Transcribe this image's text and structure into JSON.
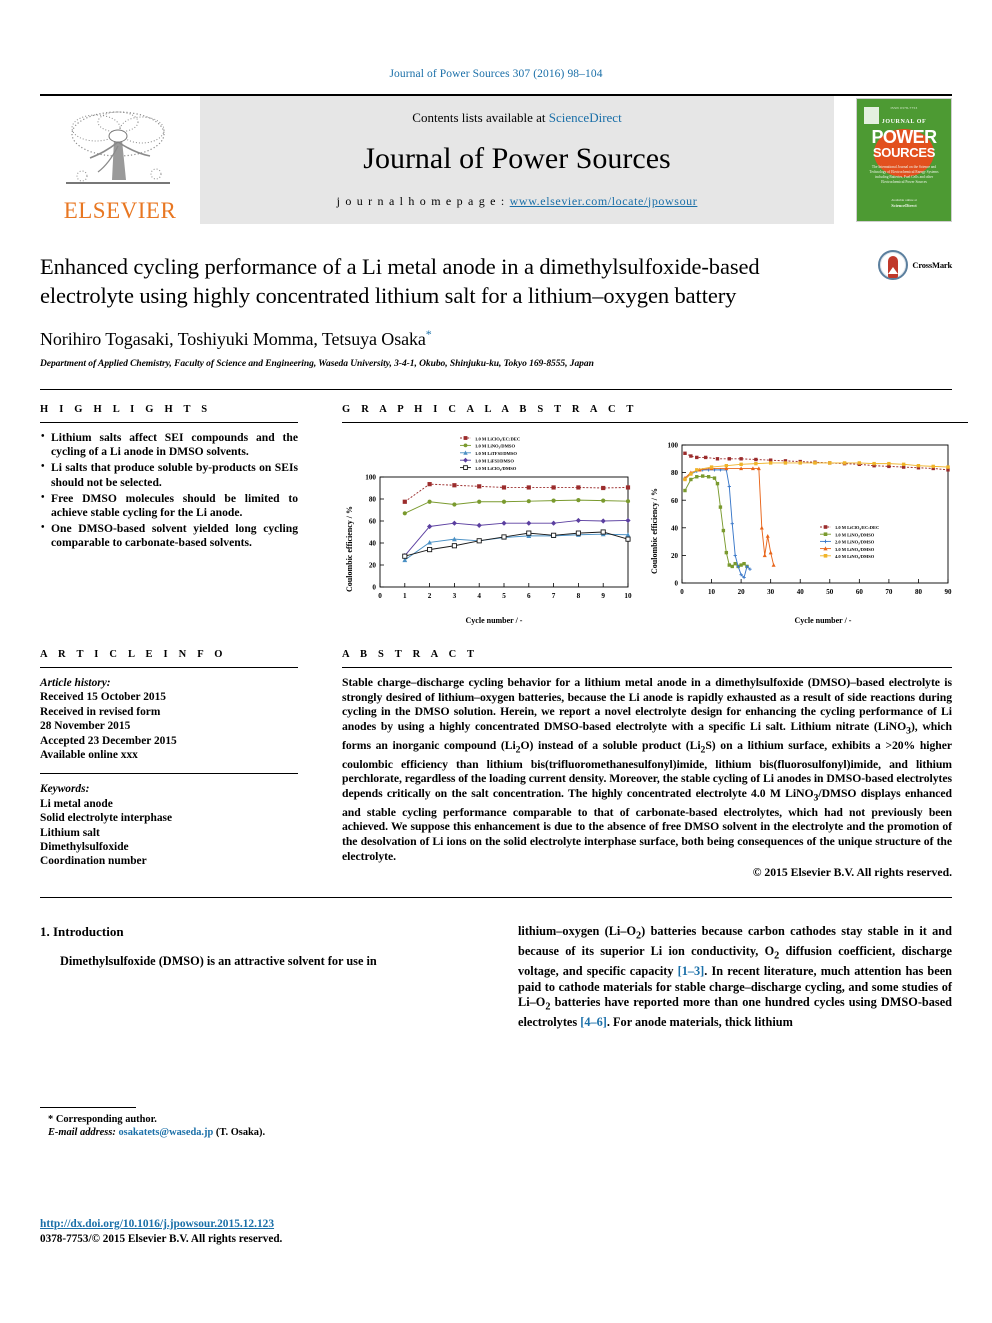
{
  "runninghead": "Journal of Power Sources 307 (2016) 98–104",
  "masthead": {
    "contents_prefix": "Contents lists available at ",
    "sciencedirect": "ScienceDirect",
    "journal_name": "Journal of Power Sources",
    "homepage_label": "j o u r n a l   h o m e p a g e :   ",
    "homepage_url": "www.elsevier.com/locate/jpowsour",
    "elsevier_wordmark": "ELSEVIER",
    "cover": {
      "top_note": "ISSN 0378-7753",
      "journal_of": "JOURNAL OF",
      "power": "POWER",
      "sources": "SOURCES",
      "subtitle": "The International Journal on the Science and Technology of Electrochemical Energy Systems including Batteries, Fuel Cells and other Electrochemical Power Sources",
      "footer_small": "Available online at",
      "footer_brand": "ScienceDirect"
    }
  },
  "article": {
    "title": "Enhanced cycling performance of a Li metal anode in a dimethylsulfoxide-based electrolyte using highly concentrated lithium salt for a lithium–oxygen battery",
    "authors": "Norihiro Togasaki, Toshiyuki Momma, Tetsuya Osaka",
    "affiliation": "Department of Applied Chemistry, Faculty of Science and Engineering, Waseda University, 3-4-1, Okubo, Shinjuku-ku, Tokyo 169-8555, Japan",
    "crossmark_label": "CrossMark"
  },
  "highlights": {
    "heading": "H I G H L I G H T S",
    "items": [
      "Lithium salts affect SEI compounds and the cycling of a Li anode in DMSO solvents.",
      "Li salts that produce soluble by-products on SEIs should not be selected.",
      "Free DMSO molecules should be limited to achieve stable cycling for the Li anode.",
      "One DMSO-based solvent yielded long cycling comparable to carbonate-based solvents."
    ]
  },
  "graphical_abstract": {
    "heading": "G R A P H I C A L   A B S T R A C T"
  },
  "article_info": {
    "heading": "A R T I C L E   I N F O",
    "history_label": "Article history:",
    "history": [
      "Received 15 October 2015",
      "Received in revised form",
      "28 November 2015",
      "Accepted 23 December 2015",
      "Available online xxx"
    ],
    "keywords_label": "Keywords:",
    "keywords": [
      "Li metal anode",
      "Solid electrolyte interphase",
      "Lithium salt",
      "Dimethylsulfoxide",
      "Coordination number"
    ]
  },
  "abstract": {
    "heading": "A B S T R A C T",
    "text": "Stable charge–discharge cycling behavior for a lithium metal anode in a dimethylsulfoxide (DMSO)–based electrolyte is strongly desired of lithium–oxygen batteries, because the Li anode is rapidly exhausted as a result of side reactions during cycling in the DMSO solution. Herein, we report a novel electrolyte design for enhancing the cycling performance of Li anodes by using a highly concentrated DMSO-based electrolyte with a specific Li salt. Lithium nitrate (LiNO3), which forms an inorganic compound (Li2O) instead of a soluble product (Li2S) on a lithium surface, exhibits a >20% higher coulombic efficiency than lithium bis(trifluoromethanesulfonyl)imide, lithium bis(fluorosulfonyl)imide, and lithium perchlorate, regardless of the loading current density. Moreover, the stable cycling of Li anodes in DMSO-based electrolytes depends critically on the salt concentration. The highly concentrated electrolyte 4.0 M LiNO3/DMSO displays enhanced and stable cycling performance comparable to that of carbonate-based electrolytes, which had not previously been achieved. We suppose this enhancement is due to the absence of free DMSO solvent in the electrolyte and the promotion of the desolvation of Li ions on the solid electrolyte interphase surface, both being consequences of the unique structure of the electrolyte.",
    "copyright": "© 2015 Elsevier B.V. All rights reserved."
  },
  "body": {
    "intro_heading": "1.  Introduction",
    "left_paragraph": "Dimethylsulfoxide (DMSO) is an attractive solvent for use in",
    "right_paragraph_a": "lithium–oxygen (Li–O2) batteries because carbon cathodes stay stable in it and because of its superior Li ion conductivity, O2 diffusion coefficient, discharge voltage, and specific capacity ",
    "right_ref_1": "[1–3]",
    "right_paragraph_b": ". In recent literature, much attention has been paid to cathode materials for stable charge–discharge cycling, and some studies of Li–O2 batteries have reported more than one hundred cycles using DMSO-based electrolytes ",
    "right_ref_2": "[4–6]",
    "right_paragraph_c": ". For anode materials, thick lithium"
  },
  "footer": {
    "corresponding": "Corresponding author.",
    "email_label": "E-mail address:",
    "email": "osakatets@waseda.jp",
    "email_suffix": "(T. Osaka).",
    "doi": "http://dx.doi.org/10.1016/j.jpowsour.2015.12.123",
    "issn": "0378-7753/© 2015 Elsevier B.V. All rights reserved."
  },
  "colors": {
    "link": "#1a6fa8",
    "elsevier_orange": "#E87722",
    "cover_green": "#4d9a33",
    "cover_sun": "#e2501e"
  },
  "chart_data": [
    {
      "type": "line",
      "title": "",
      "xlabel": "Cycle number / -",
      "ylabel": "Coulombic efficiency / %",
      "xlim": [
        0,
        10
      ],
      "ylim": [
        0,
        100
      ],
      "xticks": [
        0,
        1,
        2,
        3,
        4,
        5,
        6,
        7,
        8,
        9,
        10
      ],
      "yticks": [
        0,
        20,
        40,
        60,
        80,
        100
      ],
      "grid": false,
      "legend_position": "top-center",
      "x": [
        1,
        2,
        3,
        4,
        5,
        6,
        7,
        8,
        9,
        10
      ],
      "series": [
        {
          "name": "1.0 M LiClO4/EC:DEC",
          "color": "#9b2c2c",
          "marker": "square-filled",
          "dash": "dot",
          "values": [
            77.5,
            93.5,
            92.5,
            91.5,
            90.5,
            90.5,
            90.5,
            90.5,
            90,
            90.5
          ]
        },
        {
          "name": "1.0 M LiNO3/DMSO",
          "color": "#7a9a2e",
          "marker": "circle-filled",
          "dash": "solid",
          "values": [
            67,
            77.5,
            75,
            77.5,
            77.5,
            78,
            78.5,
            79,
            78.5,
            78
          ]
        },
        {
          "name": "1.0 M LiTFSI/DMSO",
          "color": "#4a90c4",
          "marker": "triangle-filled",
          "dash": "solid",
          "values": [
            24.5,
            40.5,
            43.5,
            42,
            45,
            46.5,
            46.5,
            47.5,
            48,
            47.5
          ]
        },
        {
          "name": "1.0 M LiFSI/DMSO",
          "color": "#5b3fa0",
          "marker": "diamond-filled",
          "dash": "solid",
          "values": [
            28.5,
            55,
            58,
            56,
            58,
            58,
            58,
            60.5,
            60,
            60.5
          ]
        },
        {
          "name": "1.0 M LiClO4/DMSO",
          "color": "#1a1a1a",
          "marker": "square-open",
          "dash": "solid",
          "values": [
            28,
            34,
            37.5,
            42,
            45.5,
            49,
            47,
            49,
            50,
            43.5
          ]
        }
      ]
    },
    {
      "type": "line",
      "title": "",
      "xlabel": "Cycle number / -",
      "ylabel": "Coulombic efficiency / %",
      "xlim": [
        0,
        90
      ],
      "ylim": [
        0,
        100
      ],
      "xticks": [
        0,
        10,
        20,
        30,
        40,
        50,
        60,
        70,
        80,
        90
      ],
      "yticks": [
        0,
        20,
        40,
        60,
        80,
        100
      ],
      "grid": false,
      "legend_position": "bottom-right",
      "series": [
        {
          "name": "1.0 M LiClO4/EC:DEC",
          "color": "#9b2c2c",
          "marker": "square-filled",
          "dash": "dot",
          "x": [
            1,
            3,
            5,
            8,
            12,
            16,
            20,
            25,
            30,
            35,
            40,
            45,
            50,
            55,
            60,
            65,
            70,
            75,
            80,
            85,
            90
          ],
          "values": [
            94,
            92,
            91,
            91,
            90,
            90,
            90,
            89.5,
            89,
            88.5,
            88,
            87.5,
            87,
            86.5,
            86,
            85,
            84.5,
            84,
            83.5,
            83,
            82
          ]
        },
        {
          "name": "1.0 M LiNO3/DMSO",
          "color": "#7a9a2e",
          "marker": "square-filled",
          "dash": "solid",
          "x": [
            1,
            3,
            5,
            7,
            9,
            11,
            12,
            13,
            14,
            15,
            16,
            17,
            18,
            19,
            20,
            21,
            22
          ],
          "values": [
            67,
            75,
            77,
            77.5,
            77,
            76,
            72,
            55,
            38,
            22,
            13,
            12,
            14,
            12,
            13,
            14,
            12
          ]
        },
        {
          "name": "2.0 M LiNO3/DMSO",
          "color": "#3a78c9",
          "marker": "plus",
          "dash": "solid",
          "x": [
            1,
            3,
            5,
            7,
            9,
            11,
            13,
            15,
            16,
            17,
            18,
            19,
            20,
            21,
            22,
            23
          ],
          "values": [
            76,
            79,
            81,
            82,
            82,
            82,
            82,
            82,
            70,
            43,
            20,
            12,
            6,
            4,
            12,
            10
          ]
        },
        {
          "name": "3.0 M LiNO3/DMSO",
          "color": "#e8651a",
          "marker": "triangle-filled",
          "dash": "solid",
          "x": [
            1,
            3,
            6,
            10,
            15,
            20,
            24,
            26,
            27,
            28,
            29,
            30,
            31
          ],
          "values": [
            76,
            80,
            82,
            83,
            83,
            83,
            83,
            83,
            40,
            20,
            34,
            22,
            13
          ]
        },
        {
          "name": "4.0 M LiNO3/DMSO",
          "color": "#f0b429",
          "marker": "square-filled",
          "dash": "solid",
          "x": [
            1,
            3,
            5,
            10,
            15,
            20,
            25,
            30,
            35,
            40,
            45,
            50,
            55,
            60,
            65,
            70,
            75,
            80,
            85,
            90
          ],
          "values": [
            75,
            79,
            82,
            84,
            85,
            86,
            86.5,
            87,
            87,
            87,
            87,
            87,
            87,
            87,
            86.5,
            86.5,
            86,
            85,
            84.5,
            84
          ]
        }
      ]
    }
  ]
}
